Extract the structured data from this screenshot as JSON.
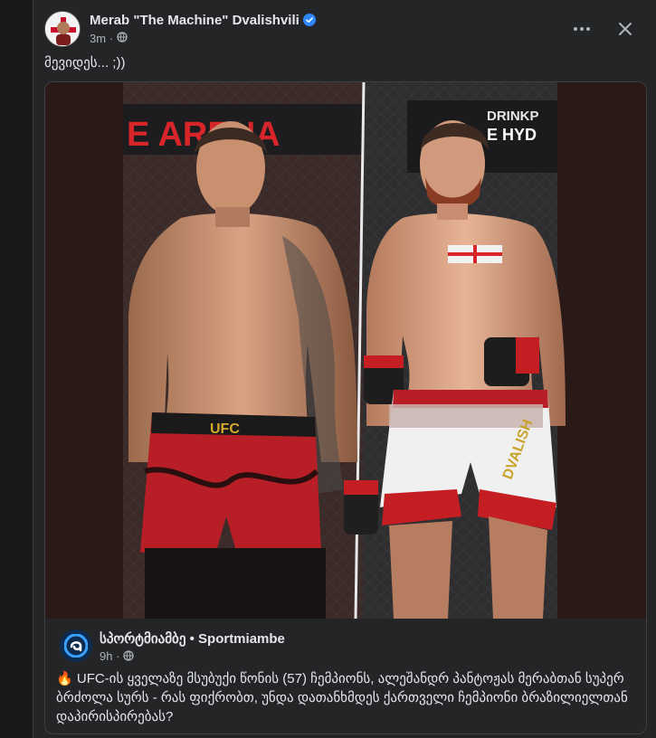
{
  "post": {
    "author": "Merab \"The Machine\" Dvalishvili",
    "time": "3m",
    "caption": "მევიდეს... ;))"
  },
  "shared": {
    "page_name": "სპორტმიამბე • Sportmiambe",
    "time": "9h",
    "text": "UFC-ის ყველაზე მსუბუქი წონის (57) ჩემპიონს, ალეშანდრ პანტოჟას მერაბთან სუპერ ბრძოლა სურს - რას ფიქრობთ, უნდა დათანხმდეს ქართველი ჩემპიონი ბრაზილიელთან დაპირისპირებას?",
    "emoji": "🔥",
    "image_text": {
      "left_banner": "E ARENA",
      "right_banner_top": "DRINKP",
      "right_banner_bottom": "E HYD",
      "left_shorts": "UFC",
      "right_shorts": "DVALISH"
    }
  },
  "icons": {
    "verified": "verified-badge-icon",
    "globe": "globe-icon",
    "more": "more-icon",
    "close": "close-icon"
  },
  "colors": {
    "background": "#18191a",
    "card": "#242526",
    "verified": "#2d88ff"
  }
}
